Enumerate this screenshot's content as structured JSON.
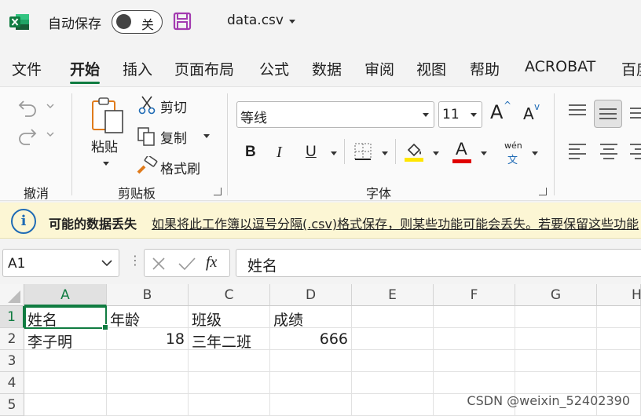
{
  "titlebar": {
    "autosave_label": "自动保存",
    "autosave_state": "关",
    "filename": "data.csv"
  },
  "tabs": [
    "文件",
    "开始",
    "插入",
    "页面布局",
    "公式",
    "数据",
    "审阅",
    "视图",
    "帮助",
    "ACROBAT",
    "百度"
  ],
  "active_tab": "开始",
  "ribbon": {
    "undo_group": "撤消",
    "clipboard": {
      "paste": "粘贴",
      "cut": "剪切",
      "copy": "复制",
      "format_painter": "格式刷",
      "group": "剪贴板"
    },
    "font": {
      "name": "等线",
      "size": "11",
      "bold": "B",
      "italic": "I",
      "underline": "U",
      "increase": "A",
      "decrease": "A",
      "font_color_letter": "A",
      "phonetic_top": "wén",
      "phonetic_bottom": "文",
      "group": "字体"
    }
  },
  "infobar": {
    "title": "可能的数据丢失",
    "message": "如果将此工作簿以逗号分隔(.csv)格式保存，则某些功能可能会丢失。若要保留这些功能"
  },
  "formula_bar": {
    "name_box": "A1",
    "fx": "fx",
    "content": "姓名"
  },
  "sheet": {
    "columns": [
      "A",
      "B",
      "C",
      "D",
      "E",
      "F",
      "G",
      "H"
    ],
    "rows": [
      "1",
      "2",
      "3",
      "4",
      "5"
    ],
    "cells": [
      [
        "姓名",
        "年龄",
        "班级",
        "成绩"
      ],
      [
        "李子明",
        "18",
        "三年二班",
        "666"
      ]
    ]
  },
  "watermark": "CSDN @weixin_52402390",
  "colors": {
    "excel_green": "#107c41",
    "info_bg": "#fcf6d4",
    "info_icon": "#1f6bb5",
    "highlight_yellow": "#ffe600",
    "font_red": "#e00000",
    "save_purple": "#a33ab0"
  }
}
